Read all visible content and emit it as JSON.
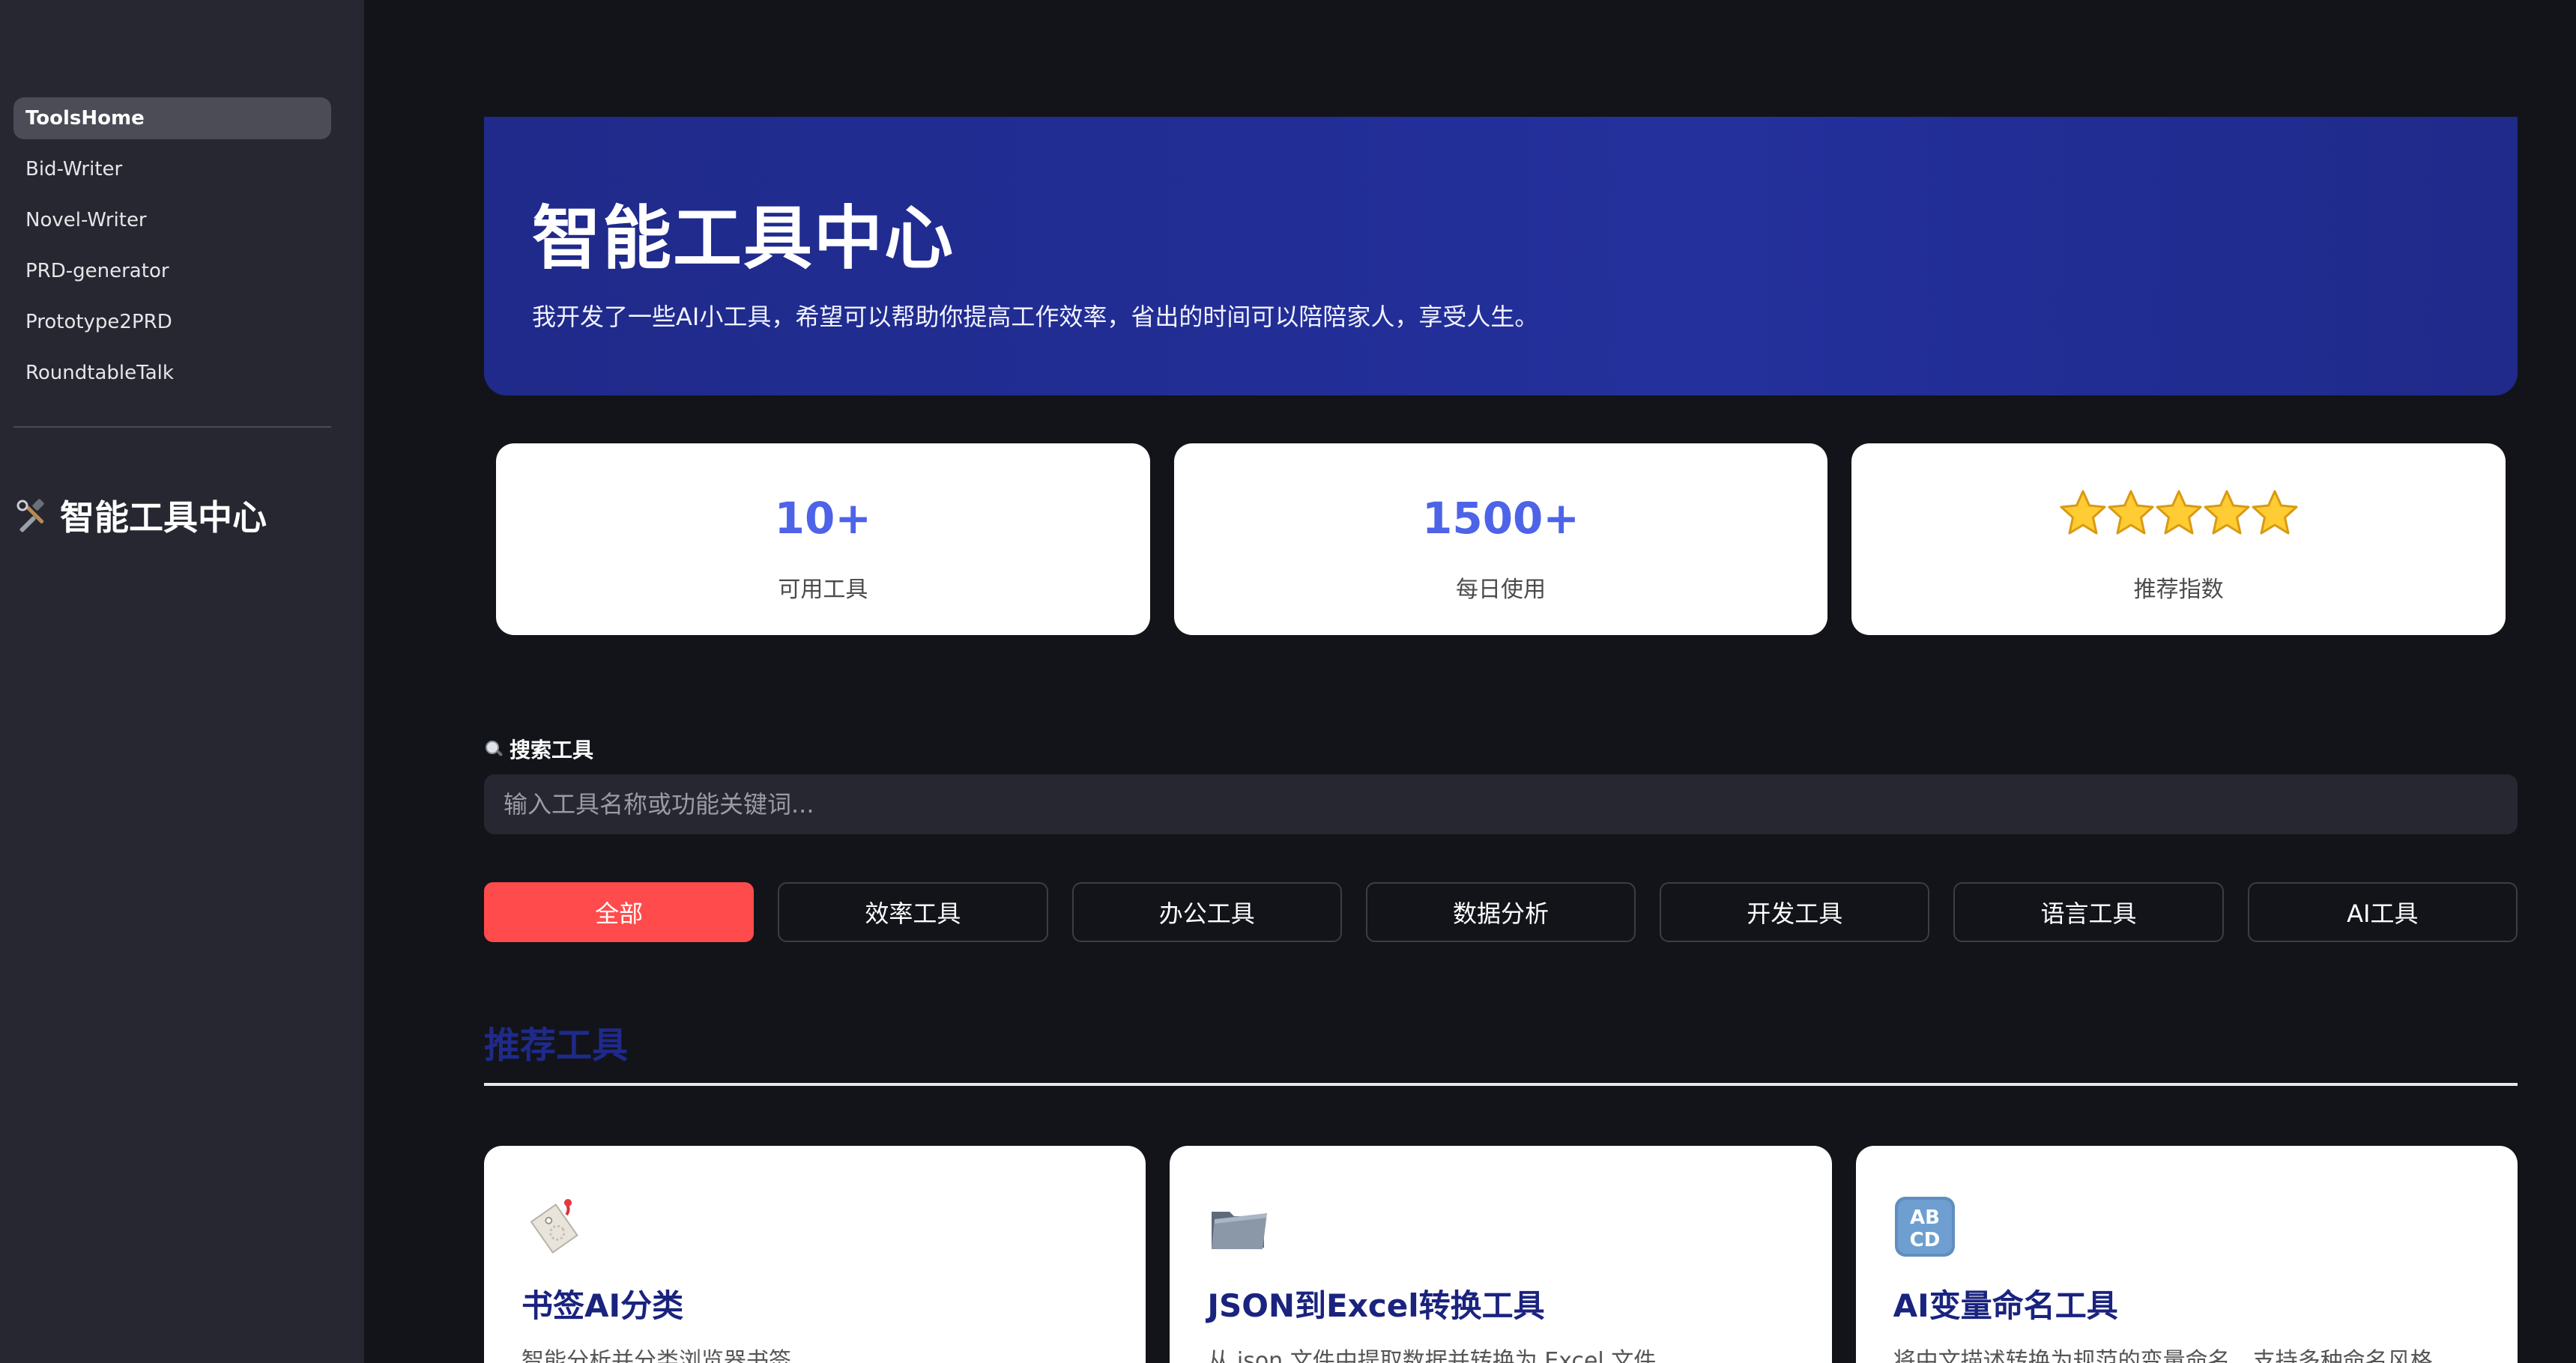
{
  "sidebar": {
    "items": [
      {
        "label": "ToolsHome",
        "active": true
      },
      {
        "label": "Bid-Writer"
      },
      {
        "label": "Novel-Writer"
      },
      {
        "label": "PRD-generator"
      },
      {
        "label": "Prototype2PRD"
      },
      {
        "label": "RoundtableTalk"
      }
    ],
    "title": "智能工具中心",
    "title_icon": "hammer-wrench-icon"
  },
  "hero": {
    "title": "智能工具中心",
    "description": "我开发了一些AI小工具，希望可以帮助你提高工作效率，省出的时间可以陪陪家人，享受人生。"
  },
  "stats": [
    {
      "value": "10+",
      "label": "可用工具"
    },
    {
      "value": "1500+",
      "label": "每日使用"
    },
    {
      "value": "★★★★★",
      "stars": 5,
      "label": "推荐指数"
    }
  ],
  "search": {
    "label": "搜索工具",
    "icon": "magnifier-icon",
    "placeholder": "输入工具名称或功能关键词..."
  },
  "filters": [
    {
      "label": "全部",
      "active": true
    },
    {
      "label": "效率工具"
    },
    {
      "label": "办公工具"
    },
    {
      "label": "数据分析"
    },
    {
      "label": "开发工具"
    },
    {
      "label": "语言工具"
    },
    {
      "label": "AI工具"
    }
  ],
  "section": {
    "title": "推荐工具"
  },
  "cards": [
    {
      "icon": "bookmark-tag-icon",
      "title": "书签AI分类",
      "description": "智能分析并分类浏览器书签"
    },
    {
      "icon": "folder-icon",
      "title": "JSON到Excel转换工具",
      "description": "从 json 文件中提取数据并转换为 Excel 文件"
    },
    {
      "icon": "abcd-icon",
      "title": "AI变量命名工具",
      "description": "将中文描述转换为规范的变量命名，支持多种命名风格"
    }
  ],
  "colors": {
    "accent": "#ff4b4b",
    "hero": "#1f2a8a",
    "stat_value": "#4d63e8",
    "sidebar_bg": "#262730",
    "page_bg": "#13141a"
  }
}
